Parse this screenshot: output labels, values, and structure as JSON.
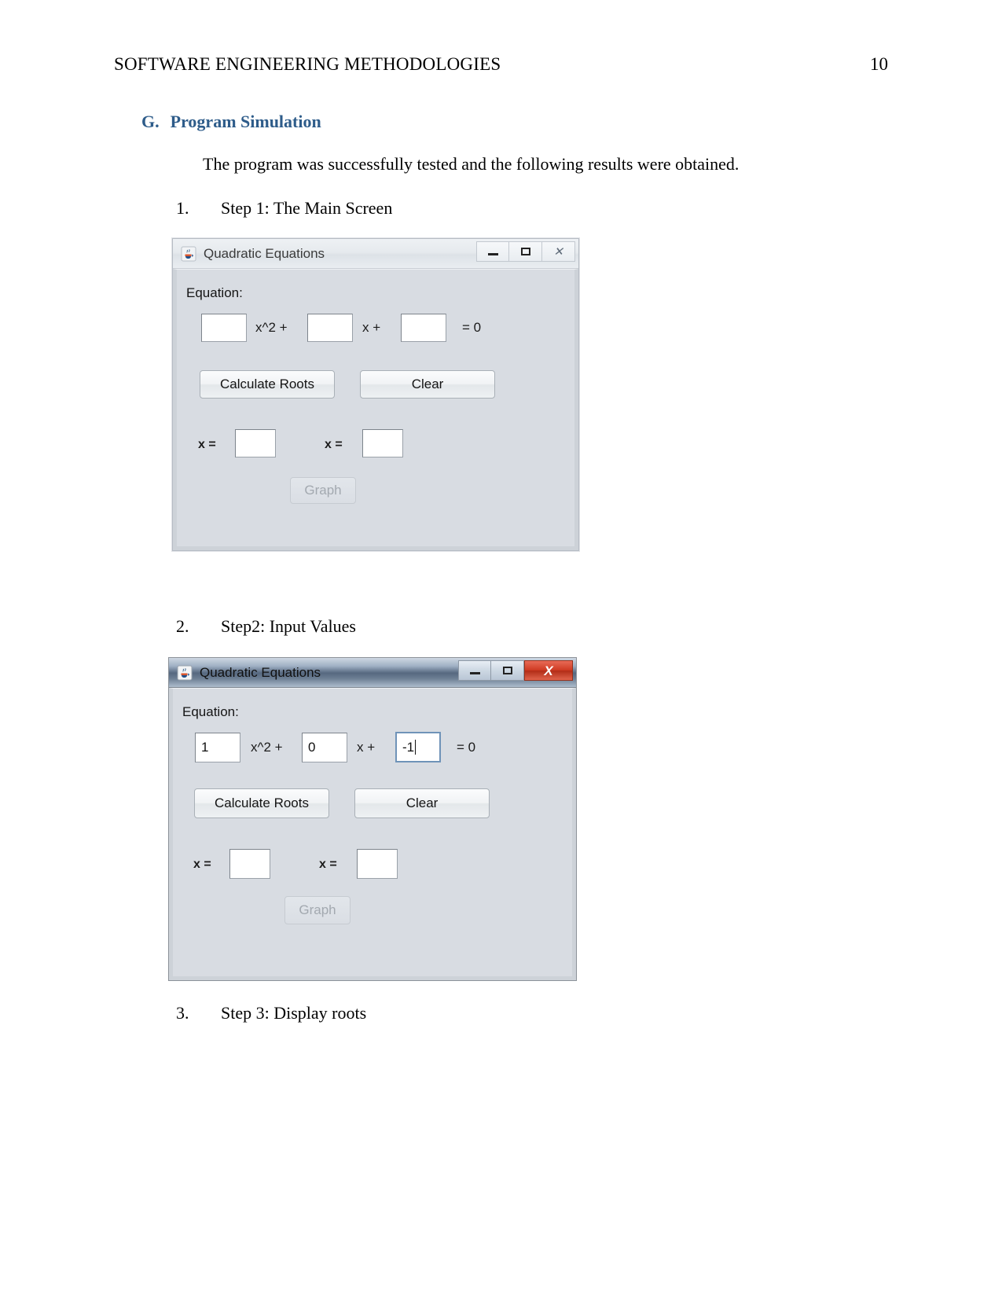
{
  "header": {
    "running_title": "SOFTWARE ENGINEERING METHODOLOGIES",
    "page_number": "10"
  },
  "section": {
    "letter": "G.",
    "title": "Program Simulation"
  },
  "intro_paragraph": "The program was successfully tested and the following results were obtained.",
  "steps": [
    {
      "number": "1.",
      "label": "Step 1: The Main Screen"
    },
    {
      "number": "2.",
      "label": "Step2: Input Values"
    },
    {
      "number": "3.",
      "label": "Step 3: Display roots"
    }
  ],
  "window_main": {
    "title": "Quadratic Equations",
    "state": "inactive",
    "icon": "java-cup-icon",
    "titlebar_buttons": {
      "minimize": "minimize-icon",
      "maximize": "maximize-icon",
      "close": "✕"
    },
    "equation_label": "Equation:",
    "coefficient_a": "",
    "operator_1": "x^2  +",
    "coefficient_b": "",
    "operator_2": "x  +",
    "coefficient_c": "",
    "equals_text": "=  0",
    "calculate_button": "Calculate Roots",
    "clear_button": "Clear",
    "root1_label": "x =",
    "root1_value": "",
    "root2_label": "x =",
    "root2_value": "",
    "graph_button": "Graph",
    "graph_button_enabled": false
  },
  "window_input": {
    "title": "Quadratic Equations",
    "state": "active",
    "icon": "java-cup-icon",
    "titlebar_buttons": {
      "minimize": "minimize-icon",
      "maximize": "maximize-icon",
      "close": "X"
    },
    "equation_label": "Equation:",
    "coefficient_a": "1",
    "operator_1": "x^2  +",
    "coefficient_b": "0",
    "operator_2": "x  +",
    "coefficient_c": "-1",
    "coefficient_c_focused": true,
    "equals_text": "=  0",
    "calculate_button": "Calculate Roots",
    "clear_button": "Clear",
    "root1_label": "x =",
    "root1_value": "",
    "root2_label": "x =",
    "root2_value": "",
    "graph_button": "Graph",
    "graph_button_enabled": false
  },
  "colors": {
    "heading_blue": "#2e5c8a",
    "window_bg": "#d8dce2",
    "close_red": "#cf3b23",
    "focus_border": "#6f93b8"
  }
}
